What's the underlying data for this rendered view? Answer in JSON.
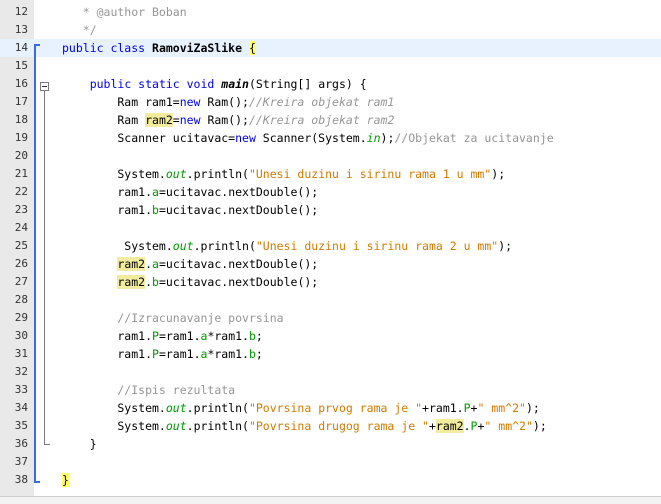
{
  "lines": [
    {
      "n": "12",
      "hl": false,
      "parts": [
        {
          "t": "   * @author Boban",
          "c": "cm"
        }
      ]
    },
    {
      "n": "13",
      "hl": false,
      "parts": [
        {
          "t": "   */",
          "c": "cm"
        }
      ]
    },
    {
      "n": "14",
      "hl": true,
      "parts": [
        {
          "t": "public class ",
          "c": "kw"
        },
        {
          "t": "RamoviZaSlike",
          "c": "cls"
        },
        {
          "t": " "
        },
        {
          "t": "{",
          "c": "brace"
        }
      ]
    },
    {
      "n": "15",
      "hl": false,
      "parts": []
    },
    {
      "n": "16",
      "hl": false,
      "parts": [
        {
          "t": "    "
        },
        {
          "t": "public static void ",
          "c": "kw"
        },
        {
          "t": "main",
          "c": "mth"
        },
        {
          "t": "(String[] args) {"
        }
      ]
    },
    {
      "n": "17",
      "hl": false,
      "parts": [
        {
          "t": "        Ram ram1="
        },
        {
          "t": "new",
          "c": "kw"
        },
        {
          "t": " Ram();"
        },
        {
          "t": "//Kreira objekat ram1",
          "c": "cmi"
        }
      ]
    },
    {
      "n": "18",
      "hl": false,
      "parts": [
        {
          "t": "        Ram "
        },
        {
          "t": "ram2",
          "c": "mark"
        },
        {
          "t": "="
        },
        {
          "t": "new",
          "c": "kw"
        },
        {
          "t": " Ram();"
        },
        {
          "t": "//Kreira objekat ram2",
          "c": "cmi"
        }
      ]
    },
    {
      "n": "19",
      "hl": false,
      "parts": [
        {
          "t": "        Scanner ucitavac="
        },
        {
          "t": "new",
          "c": "kw"
        },
        {
          "t": " Scanner(System."
        },
        {
          "t": "in",
          "c": "fldi"
        },
        {
          "t": ");"
        },
        {
          "t": "//Objekat za ucitavanje",
          "c": "cm"
        }
      ]
    },
    {
      "n": "20",
      "hl": false,
      "parts": []
    },
    {
      "n": "21",
      "hl": false,
      "parts": [
        {
          "t": "        System."
        },
        {
          "t": "out",
          "c": "fldi"
        },
        {
          "t": ".println("
        },
        {
          "t": "\"Unesi duzinu i sirinu rama 1 u mm\"",
          "c": "str"
        },
        {
          "t": ");"
        }
      ]
    },
    {
      "n": "22",
      "hl": false,
      "parts": [
        {
          "t": "        ram1."
        },
        {
          "t": "a",
          "c": "fld"
        },
        {
          "t": "=ucitavac.nextDouble();"
        }
      ]
    },
    {
      "n": "23",
      "hl": false,
      "parts": [
        {
          "t": "        ram1."
        },
        {
          "t": "b",
          "c": "fld"
        },
        {
          "t": "=ucitavac.nextDouble();"
        }
      ]
    },
    {
      "n": "24",
      "hl": false,
      "parts": []
    },
    {
      "n": "25",
      "hl": false,
      "parts": [
        {
          "t": "         System."
        },
        {
          "t": "out",
          "c": "fldi"
        },
        {
          "t": ".println("
        },
        {
          "t": "\"Unesi duzinu i sirinu rama 2 u mm\"",
          "c": "str"
        },
        {
          "t": ");"
        }
      ]
    },
    {
      "n": "26",
      "hl": false,
      "parts": [
        {
          "t": "        "
        },
        {
          "t": "ram2",
          "c": "mark"
        },
        {
          "t": "."
        },
        {
          "t": "a",
          "c": "fld"
        },
        {
          "t": "=ucitavac.nextDouble();"
        }
      ]
    },
    {
      "n": "27",
      "hl": false,
      "parts": [
        {
          "t": "        "
        },
        {
          "t": "ram2",
          "c": "mark"
        },
        {
          "t": "."
        },
        {
          "t": "b",
          "c": "fld"
        },
        {
          "t": "=ucitavac.nextDouble();"
        }
      ]
    },
    {
      "n": "28",
      "hl": false,
      "parts": []
    },
    {
      "n": "29",
      "hl": false,
      "parts": [
        {
          "t": "        //Izracunavanje povrsina",
          "c": "cm"
        }
      ]
    },
    {
      "n": "30",
      "hl": false,
      "parts": [
        {
          "t": "        ram1."
        },
        {
          "t": "P",
          "c": "fld"
        },
        {
          "t": "=ram1."
        },
        {
          "t": "a",
          "c": "fld"
        },
        {
          "t": "*ram1."
        },
        {
          "t": "b",
          "c": "fld"
        },
        {
          "t": ";"
        }
      ]
    },
    {
      "n": "31",
      "hl": false,
      "parts": [
        {
          "t": "        ram1."
        },
        {
          "t": "P",
          "c": "fld"
        },
        {
          "t": "=ram1."
        },
        {
          "t": "a",
          "c": "fld"
        },
        {
          "t": "*ram1."
        },
        {
          "t": "b",
          "c": "fld"
        },
        {
          "t": ";"
        }
      ]
    },
    {
      "n": "32",
      "hl": false,
      "parts": []
    },
    {
      "n": "33",
      "hl": false,
      "parts": [
        {
          "t": "        //Ispis rezultata",
          "c": "cm"
        }
      ]
    },
    {
      "n": "34",
      "hl": false,
      "parts": [
        {
          "t": "        System."
        },
        {
          "t": "out",
          "c": "fldi"
        },
        {
          "t": ".println("
        },
        {
          "t": "\"Povrsina prvog rama je \"",
          "c": "str"
        },
        {
          "t": "+ram1."
        },
        {
          "t": "P",
          "c": "fld"
        },
        {
          "t": "+"
        },
        {
          "t": "\" mm^2\"",
          "c": "str"
        },
        {
          "t": ");"
        }
      ]
    },
    {
      "n": "35",
      "hl": false,
      "parts": [
        {
          "t": "        System."
        },
        {
          "t": "out",
          "c": "fldi"
        },
        {
          "t": ".println("
        },
        {
          "t": "\"Povrsina drugog rama je \"",
          "c": "str"
        },
        {
          "t": "+"
        },
        {
          "t": "ram2",
          "c": "mark"
        },
        {
          "t": "."
        },
        {
          "t": "P",
          "c": "fld"
        },
        {
          "t": "+"
        },
        {
          "t": "\" mm^2\"",
          "c": "str"
        },
        {
          "t": ");"
        }
      ]
    },
    {
      "n": "36",
      "hl": false,
      "parts": [
        {
          "t": "    }"
        }
      ]
    },
    {
      "n": "37",
      "hl": false,
      "parts": []
    },
    {
      "n": "38",
      "hl": false,
      "parts": [
        {
          "t": "}",
          "c": "brace"
        }
      ]
    }
  ]
}
